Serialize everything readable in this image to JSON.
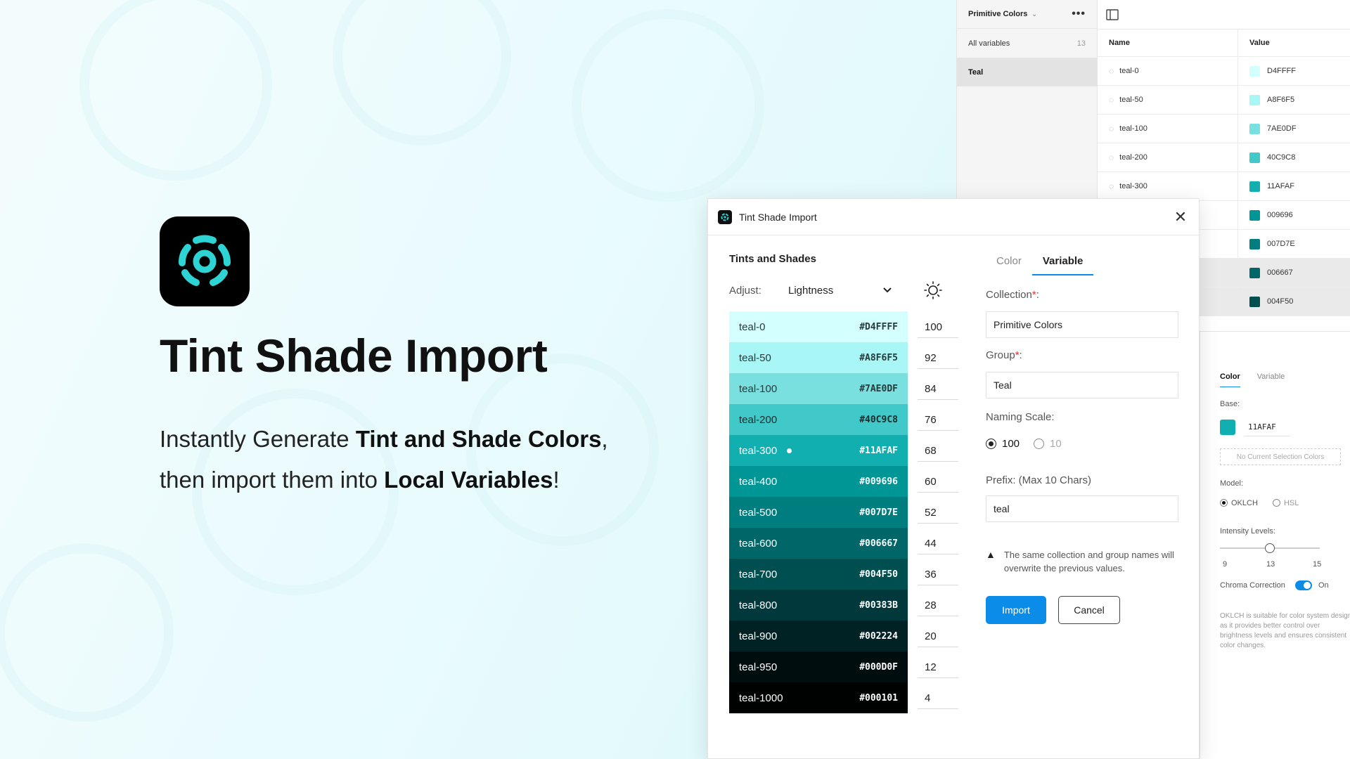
{
  "hero": {
    "title": "Tint Shade Import",
    "sub_line1_prefix": "Instantly Generate ",
    "sub_line1_bold": "Tint and Shade Colors",
    "sub_line1_suffix": ",",
    "sub_line2_prefix": "then import them into ",
    "sub_line2_bold": "Local Variables",
    "sub_line2_suffix": "!"
  },
  "variables_panel": {
    "collection": "Primitive Colors",
    "all_variables_label": "All variables",
    "all_variables_count": "13",
    "group": "Teal",
    "col_name": "Name",
    "col_value": "Value",
    "rows": [
      {
        "name": "teal-0",
        "value": "D4FFFF",
        "color": "#D4FFFF"
      },
      {
        "name": "teal-50",
        "value": "A8F6F5",
        "color": "#A8F6F5"
      },
      {
        "name": "teal-100",
        "value": "7AE0DF",
        "color": "#7AE0DF"
      },
      {
        "name": "teal-200",
        "value": "40C9C8",
        "color": "#40C9C8"
      },
      {
        "name": "teal-300",
        "value": "11AFAF",
        "color": "#11AFAF"
      },
      {
        "name": "",
        "value": "009696",
        "color": "#009696"
      },
      {
        "name": "",
        "value": "007D7E",
        "color": "#007D7E"
      },
      {
        "name": "",
        "value": "006667",
        "color": "#006667"
      },
      {
        "name": "",
        "value": "004F50",
        "color": "#004F50"
      }
    ]
  },
  "settings_panel": {
    "tab_color": "Color",
    "tab_variable": "Variable",
    "base_label": "Base:",
    "base_hex": "11AFAF",
    "no_selection": "No Current Selection Colors",
    "model_label": "Model:",
    "model_oklch": "OKLCH",
    "model_hsl": "HSL",
    "intensity_label": "Intensity Levels:",
    "intensity_min": "9",
    "intensity_value": "13",
    "intensity_max": "15",
    "chroma_label": "Chroma Correction",
    "chroma_state": "On",
    "description": "OKLCH is suitable for color system design as it provides better control over brightness levels and ensures consistent color changes."
  },
  "dialog": {
    "title": "Tint Shade Import",
    "section_title": "Tints and Shades",
    "adjust_label": "Adjust:",
    "adjust_value": "Lightness",
    "tab_color": "Color",
    "tab_variable": "Variable",
    "collection_label": "Collection",
    "collection_value": "Primitive Colors",
    "group_label": "Group",
    "group_value": "Teal",
    "naming_label": "Naming Scale:",
    "naming_100": "100",
    "naming_10": "10",
    "prefix_label": "Prefix: (Max 10 Chars)",
    "prefix_value": "teal",
    "warning": "The same collection and group names will overwrite the previous values.",
    "import_label": "Import",
    "cancel_label": "Cancel",
    "swatches": [
      {
        "name": "teal-0",
        "hex": "#D4FFFF",
        "value": "100",
        "color": "#D4FFFF",
        "text": "#2a3a3a"
      },
      {
        "name": "teal-50",
        "hex": "#A8F6F5",
        "value": "92",
        "color": "#A8F6F5",
        "text": "#2a3a3a"
      },
      {
        "name": "teal-100",
        "hex": "#7AE0DF",
        "value": "84",
        "color": "#7AE0DF",
        "text": "#2a3a3a"
      },
      {
        "name": "teal-200",
        "hex": "#40C9C8",
        "value": "76",
        "color": "#40C9C8",
        "text": "#1a2a2a"
      },
      {
        "name": "teal-300",
        "hex": "#11AFAF",
        "value": "68",
        "color": "#11AFAF",
        "text": "#ffffff",
        "base": true
      },
      {
        "name": "teal-400",
        "hex": "#009696",
        "value": "60",
        "color": "#009696",
        "text": "#ffffff"
      },
      {
        "name": "teal-500",
        "hex": "#007D7E",
        "value": "52",
        "color": "#007D7E",
        "text": "#ffffff"
      },
      {
        "name": "teal-600",
        "hex": "#006667",
        "value": "44",
        "color": "#006667",
        "text": "#ffffff"
      },
      {
        "name": "teal-700",
        "hex": "#004F50",
        "value": "36",
        "color": "#004F50",
        "text": "#ffffff"
      },
      {
        "name": "teal-800",
        "hex": "#00383B",
        "value": "28",
        "color": "#00383B",
        "text": "#ffffff"
      },
      {
        "name": "teal-900",
        "hex": "#002224",
        "value": "20",
        "color": "#002224",
        "text": "#ffffff"
      },
      {
        "name": "teal-950",
        "hex": "#000D0F",
        "value": "12",
        "color": "#000D0F",
        "text": "#ffffff"
      },
      {
        "name": "teal-1000",
        "hex": "#000101",
        "value": "4",
        "color": "#000101",
        "text": "#ffffff"
      }
    ]
  },
  "colors": {
    "accent": "#0c8ce9",
    "brand_teal": "#2ed3d3",
    "required": "#e03030"
  }
}
